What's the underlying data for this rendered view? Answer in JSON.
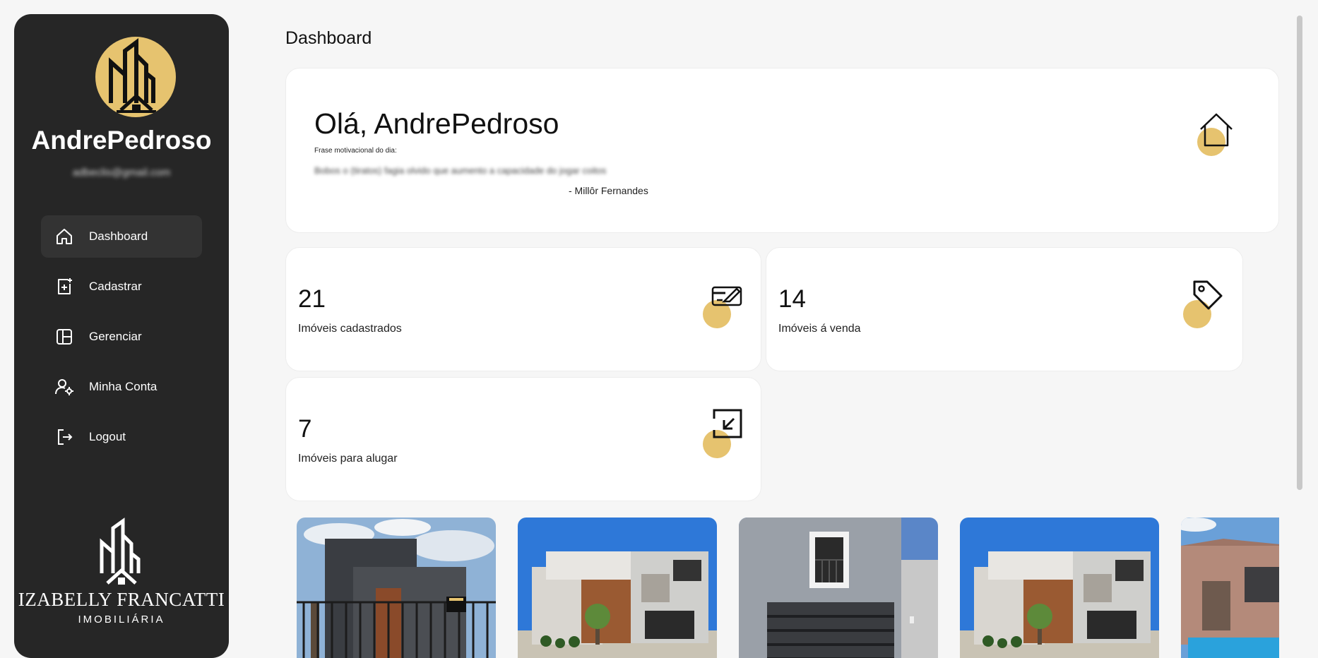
{
  "user": {
    "name": "AndrePedroso",
    "email": "adbeclis@gmail.com"
  },
  "nav": {
    "items": [
      {
        "label": "Dashboard",
        "icon": "home-icon"
      },
      {
        "label": "Cadastrar",
        "icon": "add-file-icon"
      },
      {
        "label": "Gerenciar",
        "icon": "layout-icon"
      },
      {
        "label": "Minha Conta",
        "icon": "user-settings-icon"
      },
      {
        "label": "Logout",
        "icon": "logout-icon"
      }
    ]
  },
  "brand": {
    "name": "IZABELLY FRANCATTI",
    "sub": "IMOBILIÁRIA"
  },
  "page": {
    "title": "Dashboard"
  },
  "welcome": {
    "greeting": "Olá, AndrePedroso",
    "quote_label": "Frase motivacional do dia:",
    "quote_text": "Bobos o (tiratos) fagia olvido que aumento a capacidade do jogar coitos",
    "quote_author": "- Millôr Fernandes"
  },
  "stats": [
    {
      "value": "21",
      "label": "Imóveis cadastrados",
      "icon": "card-edit-icon"
    },
    {
      "value": "14",
      "label": "Imóveis á venda",
      "icon": "tag-icon"
    },
    {
      "value": "7",
      "label": "Imóveis para alugar",
      "icon": "enter-box-icon"
    }
  ],
  "colors": {
    "accent": "#e6c36f",
    "sidebar": "#262626",
    "background": "#f6f6f6"
  }
}
